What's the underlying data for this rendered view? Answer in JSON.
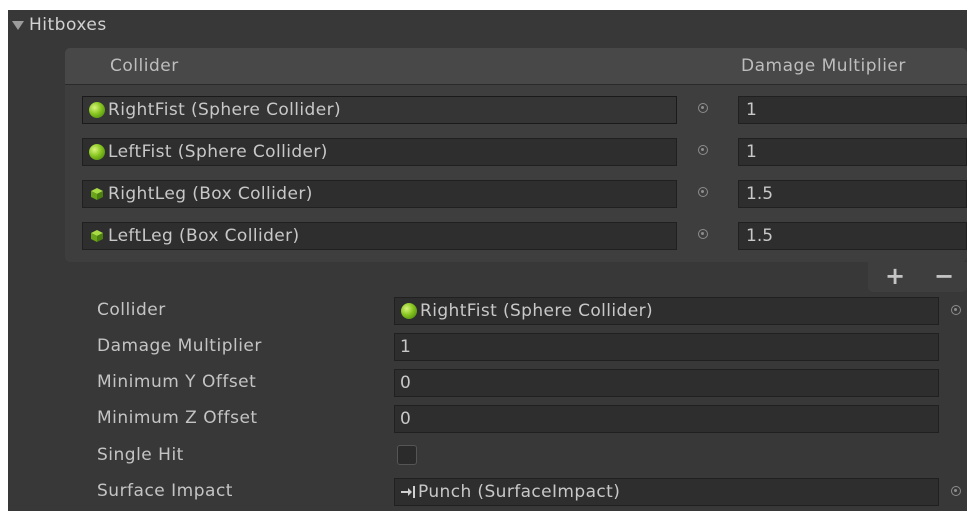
{
  "section": {
    "title": "Hitboxes"
  },
  "list": {
    "columns": {
      "collider": "Collider",
      "damage": "Damage Multiplier"
    },
    "rows": [
      {
        "collider": "RightFist (Sphere Collider)",
        "icon": "sphere-collider-icon",
        "damage": "1"
      },
      {
        "collider": "LeftFist (Sphere Collider)",
        "icon": "sphere-collider-icon",
        "damage": "1"
      },
      {
        "collider": "RightLeg (Box Collider)",
        "icon": "box-collider-icon",
        "damage": "1.5"
      },
      {
        "collider": "LeftLeg (Box Collider)",
        "icon": "box-collider-icon",
        "damage": "1.5"
      }
    ],
    "add_label": "+",
    "remove_label": "−"
  },
  "properties": {
    "collider": {
      "label": "Collider",
      "value": "RightFist (Sphere Collider)",
      "icon": "sphere-collider-icon"
    },
    "damage_multiplier": {
      "label": "Damage Multiplier",
      "value": "1"
    },
    "min_y_offset": {
      "label": "Minimum Y Offset",
      "value": "0"
    },
    "min_z_offset": {
      "label": "Minimum Z Offset",
      "value": "0"
    },
    "single_hit": {
      "label": "Single Hit",
      "checked": false
    },
    "surface_impact": {
      "label": "Surface Impact",
      "value": "Punch (SurfaceImpact)",
      "icon": "script-asset-icon"
    }
  },
  "colors": {
    "panel_bg": "#383838",
    "field_bg": "#2e2e2e",
    "text": "#c8c8c8",
    "sphere_accent": "#86c41f",
    "box_accent": "#7fbf22"
  }
}
